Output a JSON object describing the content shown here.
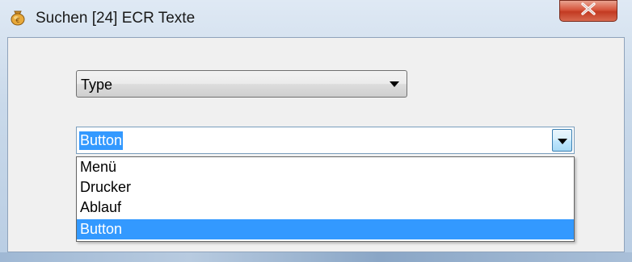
{
  "window": {
    "title": "Suchen [24] ECR Texte",
    "icon": "money-bag-icon",
    "close_label": "X"
  },
  "type_combo": {
    "selected": "Type"
  },
  "value_combo": {
    "value": "Button",
    "options": [
      "Menü",
      "Drucker",
      "Ablauf",
      "Button"
    ],
    "selected_index": 3
  },
  "colors": {
    "selection": "#3399ff",
    "close_button": "#c23a22"
  }
}
